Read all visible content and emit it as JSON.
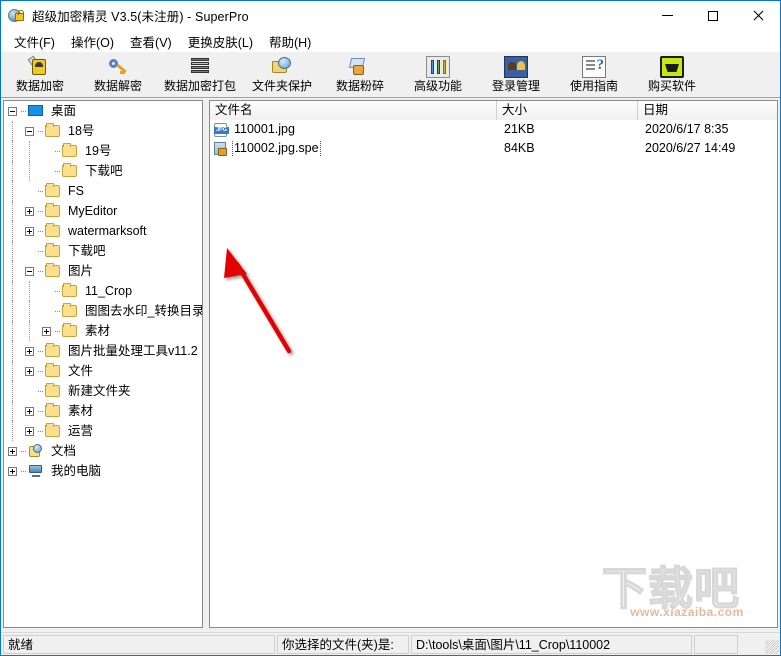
{
  "window": {
    "title": "超级加密精灵 V3.5(未注册) - SuperPro",
    "icon": "lock-globe-icon",
    "controls": {
      "minimize": "–",
      "maximize": "▢",
      "close": "✕"
    }
  },
  "menubar": {
    "items": [
      {
        "label": "文件(F)",
        "name": "menu-file"
      },
      {
        "label": "操作(O)",
        "name": "menu-operation"
      },
      {
        "label": "查看(V)",
        "name": "menu-view"
      },
      {
        "label": "更换皮肤(L)",
        "name": "menu-skin"
      },
      {
        "label": "帮助(H)",
        "name": "menu-help"
      }
    ]
  },
  "toolbar": {
    "buttons": [
      {
        "label": "数据加密",
        "icon": "lock-person-icon"
      },
      {
        "label": "数据解密",
        "icon": "key-icon"
      },
      {
        "label": "数据加密打包",
        "icon": "books-archive-icon"
      },
      {
        "label": "文件夹保护",
        "icon": "folder-shield-icon"
      },
      {
        "label": "数据粉碎",
        "icon": "shredder-icon"
      },
      {
        "label": "高级功能",
        "icon": "sliders-icon"
      },
      {
        "label": "登录管理",
        "icon": "users-icon"
      },
      {
        "label": "使用指南",
        "icon": "guide-question-icon"
      },
      {
        "label": "购买软件",
        "icon": "cart-icon"
      }
    ]
  },
  "tree": {
    "nodes": [
      {
        "label": "桌面",
        "depth": 0,
        "toggle": "minus",
        "icon": "desktop-icon"
      },
      {
        "label": "18号",
        "depth": 1,
        "toggle": "minus",
        "icon": "folder-icon"
      },
      {
        "label": "19号",
        "depth": 2,
        "toggle": "none",
        "icon": "folder-icon"
      },
      {
        "label": "下载吧",
        "depth": 2,
        "toggle": "none",
        "icon": "folder-icon"
      },
      {
        "label": "FS",
        "depth": 1,
        "toggle": "none",
        "icon": "folder-icon"
      },
      {
        "label": "MyEditor",
        "depth": 1,
        "toggle": "plus",
        "icon": "folder-icon"
      },
      {
        "label": "watermarksoft",
        "depth": 1,
        "toggle": "plus",
        "icon": "folder-icon"
      },
      {
        "label": "下载吧",
        "depth": 1,
        "toggle": "none",
        "icon": "folder-icon"
      },
      {
        "label": "图片",
        "depth": 1,
        "toggle": "minus",
        "icon": "folder-icon"
      },
      {
        "label": "11_Crop",
        "depth": 2,
        "toggle": "none",
        "icon": "folder-icon"
      },
      {
        "label": "图图去水印_转换目录",
        "depth": 2,
        "toggle": "none",
        "icon": "folder-icon"
      },
      {
        "label": "素材",
        "depth": 2,
        "toggle": "plus",
        "icon": "folder-icon"
      },
      {
        "label": "图片批量处理工具v11.2",
        "depth": 1,
        "toggle": "plus",
        "icon": "folder-icon"
      },
      {
        "label": "文件",
        "depth": 1,
        "toggle": "plus",
        "icon": "folder-icon"
      },
      {
        "label": "新建文件夹",
        "depth": 1,
        "toggle": "none",
        "icon": "folder-icon"
      },
      {
        "label": "素材",
        "depth": 1,
        "toggle": "plus",
        "icon": "folder-icon"
      },
      {
        "label": "运营",
        "depth": 1,
        "toggle": "plus",
        "icon": "folder-icon"
      },
      {
        "label": "文档",
        "depth": 0,
        "toggle": "plus",
        "icon": "documents-icon"
      },
      {
        "label": "我的电脑",
        "depth": 0,
        "toggle": "plus",
        "icon": "my-computer-icon"
      }
    ]
  },
  "filelist": {
    "columns": [
      {
        "label": "文件名",
        "name": "column-filename"
      },
      {
        "label": "大小",
        "name": "column-size"
      },
      {
        "label": "日期",
        "name": "column-date"
      }
    ],
    "rows": [
      {
        "name": "110001.jpg",
        "size": "21KB",
        "date": "2020/6/17 8:35",
        "icon": "jpg-file-icon",
        "focused": false
      },
      {
        "name": "110002.jpg.spe",
        "size": "84KB",
        "date": "2020/6/27 14:49",
        "icon": "encrypted-file-icon",
        "focused": true
      }
    ]
  },
  "statusbar": {
    "ready": "就绪",
    "selection_label": "你选择的文件(夹)是:",
    "selection_path": "D:\\tools\\桌面\\图片\\11_Crop\\110002",
    "end": ""
  },
  "watermark": {
    "text": "下载吧",
    "url": "www.xiazaiba.com"
  },
  "annotation": {
    "arrow_color": "#e30000"
  }
}
